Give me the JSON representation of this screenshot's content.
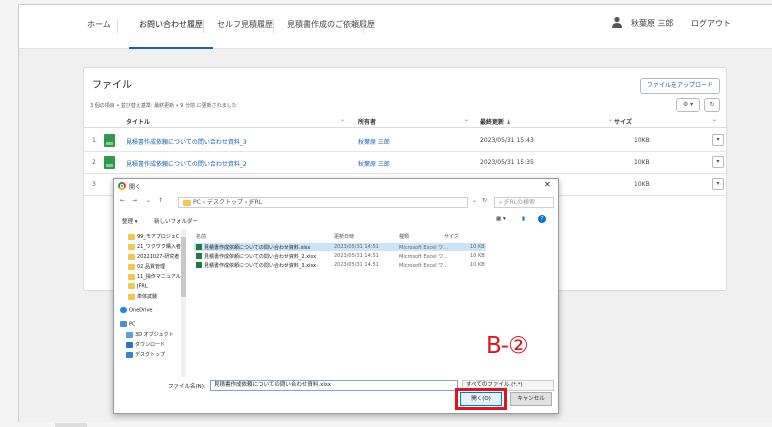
{
  "nav": {
    "tabs": [
      {
        "label": "ホーム"
      },
      {
        "label": "お問い合わせ履歴",
        "active": true
      },
      {
        "label": "セルフ見積履歴"
      },
      {
        "label": "見積書作成のご依頼履歴"
      }
    ],
    "user_name": "秋葉原 三郎",
    "logout": "ログアウト"
  },
  "files": {
    "title": "ファイル",
    "subtitle": "3 個の項目 • 並び替え基準: 最終更新 • 9 分前 に更新されました",
    "upload_button": "ファイルをアップロード",
    "settings_icon": "gear-icon",
    "refresh_icon": "refresh-icon",
    "columns": [
      "タイトル",
      "所有者",
      "最終更新 ↓",
      "サイズ"
    ],
    "rows": [
      {
        "num": "1",
        "title": "見積書作成依頼についての問い合わせ資料_3",
        "owner": "秋葉原 三郎",
        "date": "2023/05/31 15:43",
        "size": "10KB"
      },
      {
        "num": "2",
        "title": "見積書作成依頼についての問い合わせ資料_2",
        "owner": "秋葉原 三郎",
        "date": "2023/05/31 15:35",
        "size": "10KB"
      },
      {
        "num": "3",
        "title": "",
        "owner": "",
        "date": "",
        "size": "10KB"
      }
    ]
  },
  "dialog": {
    "title": "開く",
    "address": "PC › デスクトップ › JFRL",
    "search_placeholder": "JFRLの検索",
    "organize": "整理 ▾",
    "new_folder": "新しいフォルダー",
    "tree": [
      {
        "label": "99_モアプロジェC",
        "icon": "folder"
      },
      {
        "label": "21_ワクワク購入者",
        "icon": "folder"
      },
      {
        "label": "20221027-研究者",
        "icon": "folder"
      },
      {
        "label": "02.品質管理",
        "icon": "folder"
      },
      {
        "label": "11_操作マニュアル",
        "icon": "folder"
      },
      {
        "label": "JFRL",
        "icon": "folder"
      },
      {
        "label": "単体試験",
        "icon": "folder"
      },
      {
        "label": "OneDrive",
        "icon": "cloud"
      },
      {
        "label": "PC",
        "icon": "pc"
      },
      {
        "label": "3D オブジェクト",
        "icon": "3d"
      },
      {
        "label": "ダウンロード",
        "icon": "download"
      },
      {
        "label": "デスクトップ",
        "icon": "desktop"
      }
    ],
    "file_columns": [
      "名前",
      "更新日時",
      "種類",
      "サイズ"
    ],
    "file_list": [
      {
        "name": "見積書作成依頼についての問い合わせ資料.xlsx",
        "date": "2023/05/31 14:51",
        "type": "Microsoft Excel ワ...",
        "size": "10 KB",
        "selected": true
      },
      {
        "name": "見積書作成依頼についての問い合わせ資料_2.xlsx",
        "date": "2023/05/31 14:51",
        "type": "Microsoft Excel ワ...",
        "size": "10 KB"
      },
      {
        "name": "見積書作成依頼についての問い合わせ資料_3.xlsx",
        "date": "2023/05/31 14:51",
        "type": "Microsoft Excel ワ...",
        "size": "10 KB"
      }
    ],
    "filename_label": "ファイル名(N):",
    "filename_value": "見積書作成依頼についての問い合わせ資料.xlsx",
    "filetype": "すべてのファイル (*.*)",
    "open_button": "開く(O)",
    "cancel_button": "キャンセル"
  },
  "annotation": {
    "marker": "B-②",
    "highlight_color": "#e0141e"
  }
}
